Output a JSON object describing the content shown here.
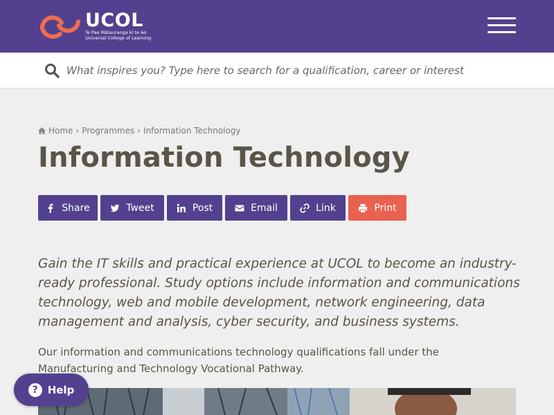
{
  "header": {
    "logo": {
      "name": "UCOL",
      "subtitle_line1": "Te Pae Mātauranga ki te Ao",
      "subtitle_line2": "Universal College of Learning"
    },
    "menu_icon": "hamburger-icon",
    "brand_color": "#53418f"
  },
  "search": {
    "placeholder": "What inspires you? Type here to search for a qualification, career or interest",
    "icon": "search-icon"
  },
  "breadcrumb": {
    "items": [
      "Home",
      "Programmes",
      "Information Technology"
    ],
    "separator": "›"
  },
  "page": {
    "title": "Information Technology",
    "intro": "Gain the IT skills and practical experience at UCOL to become an industry-ready professional. Study options include information and communications technology, web and mobile development, network engineering, data management and analysis, cyber security, and business systems.",
    "body": "Our information and communications technology qualifications fall under the Manufacturing and Technology Vocational Pathway."
  },
  "share": {
    "buttons": [
      {
        "label": "Share",
        "icon": "facebook-icon"
      },
      {
        "label": "Tweet",
        "icon": "twitter-icon"
      },
      {
        "label": "Post",
        "icon": "linkedin-icon"
      },
      {
        "label": "Email",
        "icon": "envelope-icon"
      },
      {
        "label": "Link",
        "icon": "link-icon"
      },
      {
        "label": "Print",
        "icon": "printer-icon"
      }
    ],
    "print_color": "#e8624f"
  },
  "help": {
    "label": "Help",
    "icon": "question-icon"
  }
}
